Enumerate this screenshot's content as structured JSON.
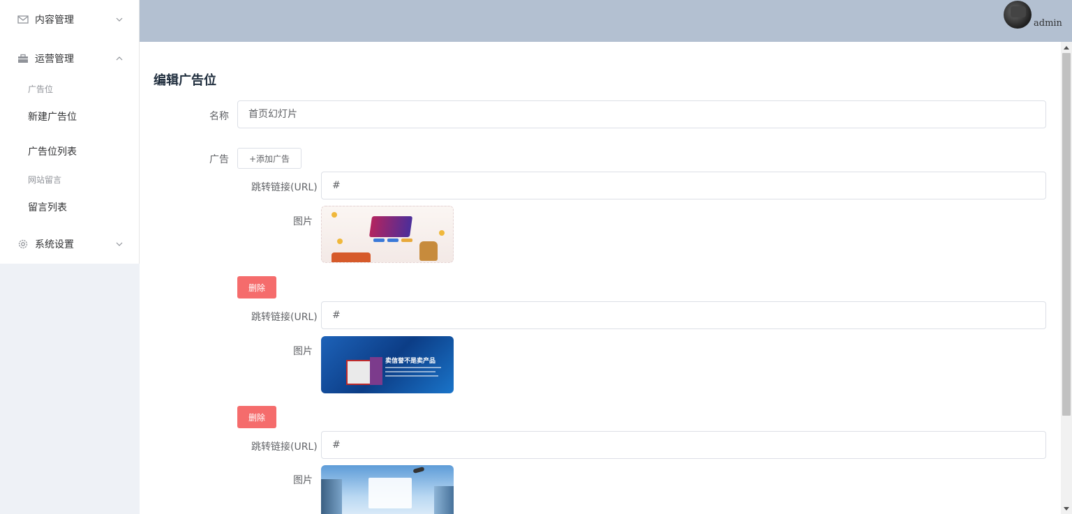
{
  "sidebar": {
    "menus": [
      {
        "label": "内容管理",
        "icon": "mail-icon",
        "expanded": false
      },
      {
        "label": "运营管理",
        "icon": "briefcase-icon",
        "expanded": true
      },
      {
        "label": "系统设置",
        "icon": "gear-icon",
        "expanded": false
      }
    ],
    "groups": [
      {
        "title": "广告位",
        "items": [
          "新建广告位",
          "广告位列表"
        ]
      },
      {
        "title": "网站留言",
        "items": [
          "留言列表"
        ]
      }
    ]
  },
  "header": {
    "username": "admin",
    "background": "#b3c0d1"
  },
  "form": {
    "title": "编辑广告位",
    "name_label": "名称",
    "name_value": "首页幻灯片",
    "ads_label": "广告",
    "add_button": "+添加广告",
    "ads": [
      {
        "url_label": "跳转链接(URL)",
        "url_value": "#",
        "image_label": "图片",
        "delete_label": "删除"
      },
      {
        "url_label": "跳转链接(URL)",
        "url_value": "#",
        "image_label": "图片",
        "delete_label": "删除"
      },
      {
        "url_label": "跳转链接(URL)",
        "url_value": "#",
        "image_label": "图片"
      }
    ],
    "banner_texts": {
      "banner2": "卖信誉不是卖产品"
    }
  },
  "colors": {
    "danger": "#f56c6c",
    "border": "#dcdfe6",
    "sidebar_bg": "#eef1f6"
  }
}
